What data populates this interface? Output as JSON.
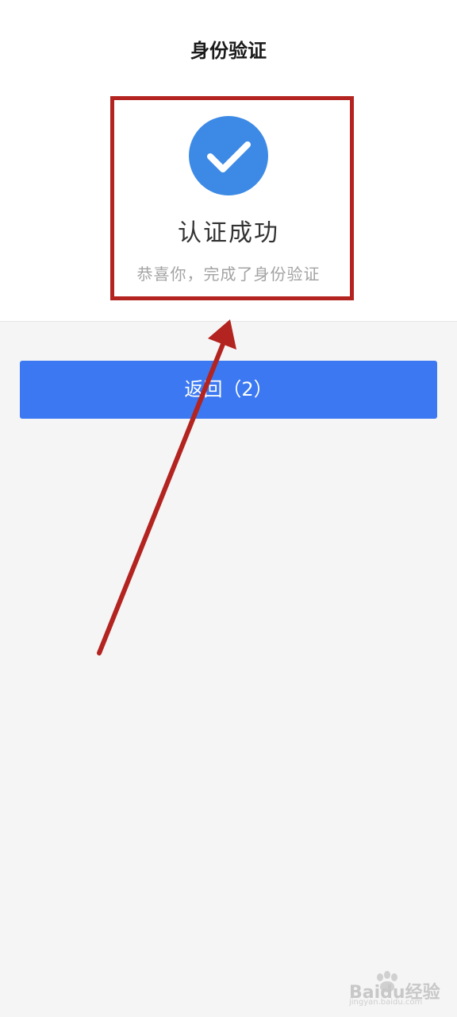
{
  "header": {
    "title": "身份验证"
  },
  "result": {
    "icon": "check-circle-icon",
    "title": "认证成功",
    "description": "恭喜你，完成了身份验证"
  },
  "actions": {
    "return_label": "返回（2）"
  },
  "annotation": {
    "box_color": "#b3231f",
    "arrow_color": "#b3231f"
  },
  "watermark": {
    "text": "Baidu经验",
    "sub": "jingyan.baidu.com"
  },
  "colors": {
    "accent": "#3b78f2",
    "check_circle": "#3d8ae6",
    "background": "#f5f5f5"
  }
}
